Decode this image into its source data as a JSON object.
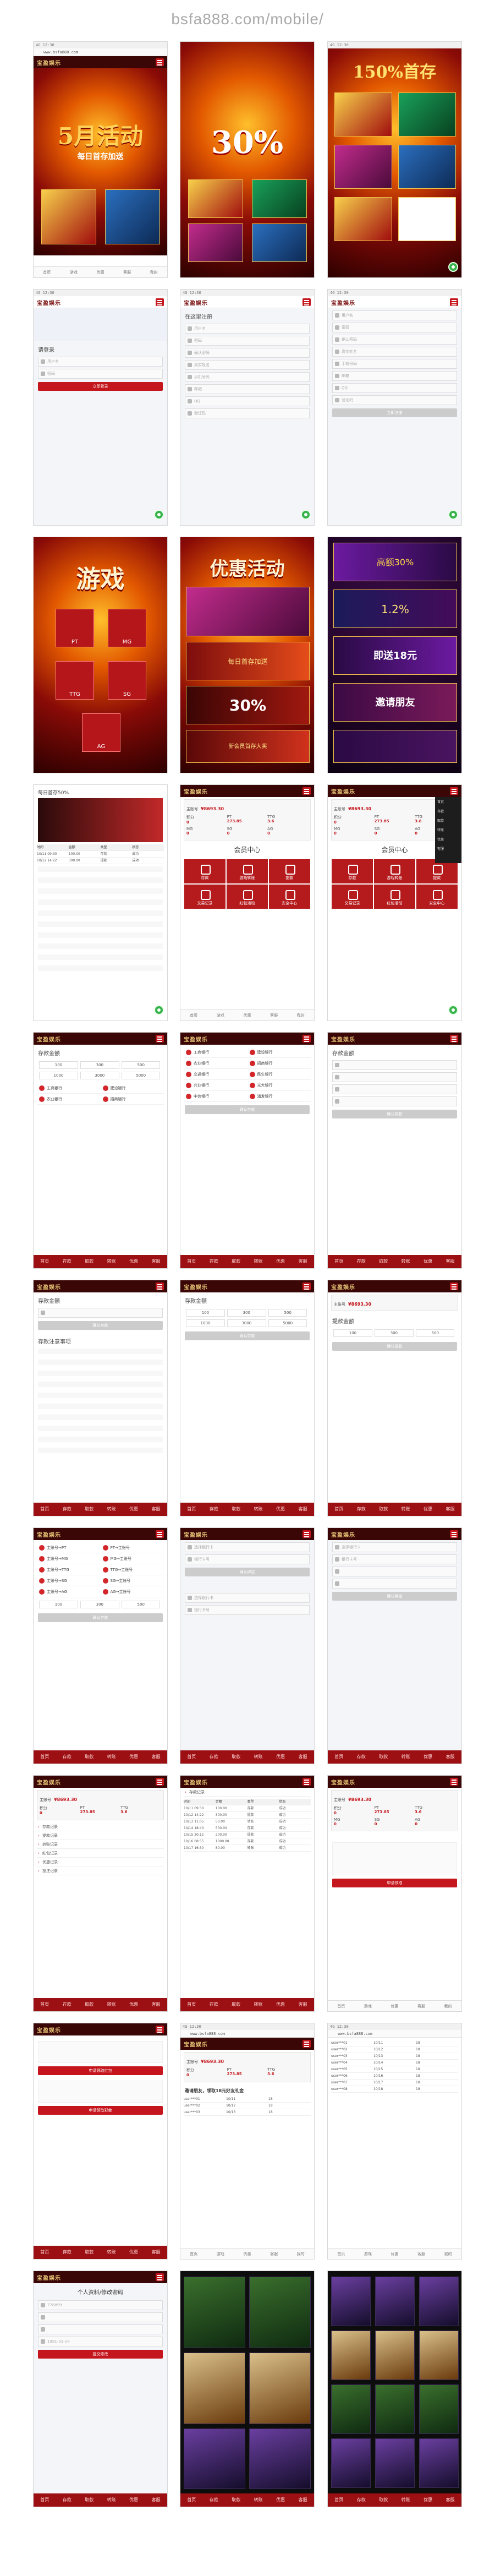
{
  "site_title": "bsfa888.com/mobile/",
  "logo_text": "宝盈娱乐",
  "status_time": "4G 12:30",
  "url_text": "www.bsfa888.com",
  "nav_items": [
    "首页",
    "存款",
    "取款",
    "转账",
    "优惠",
    "客服"
  ],
  "tab_items": [
    "首页",
    "游戏",
    "优惠",
    "客服",
    "我的"
  ],
  "row1": {
    "s1_banner": "5月活动",
    "s1_sub": "每日首存加送",
    "s2_banner": "30%",
    "s3_banner": "150%首存"
  },
  "row2": {
    "login_title": "请登录",
    "username_placeholder": "用户名",
    "password_placeholder": "密码",
    "login_btn": "立即登录",
    "register_title": "在这里注册",
    "reg_fields": [
      "用户名",
      "密码",
      "确认密码",
      "真实姓名",
      "手机号码",
      "邮箱",
      "QQ",
      "验证码"
    ],
    "submit_btn": "立即注册"
  },
  "row3": {
    "games_title": "游戏",
    "games": [
      "PT",
      "MG",
      "TTG",
      "SG",
      "AG"
    ],
    "promo_title": "优惠活动",
    "promo_items": [
      "每日首存加送",
      "30%",
      "新会员首存大奖"
    ],
    "promo2_items": [
      "高额30%",
      "1.2%",
      "即送18元",
      "邀请朋友"
    ]
  },
  "row4": {
    "bonus_title": "每日首存50%",
    "member_center": "会员中心",
    "account_label": "主账号",
    "account_amount": "¥8693.30",
    "balances": [
      {
        "name": "积分",
        "value": "0"
      },
      {
        "name": "PT",
        "value": "273.85"
      },
      {
        "name": "TTG",
        "value": "3.6"
      },
      {
        "name": "MG",
        "value": "0"
      },
      {
        "name": "SG",
        "value": "0"
      },
      {
        "name": "AG",
        "value": "0"
      }
    ],
    "center_items": [
      "存款",
      "游戏转账",
      "提款",
      "交易记录",
      "红包活动",
      "安全中心"
    ]
  },
  "row5": {
    "deposit_title": "存款金额",
    "banks": [
      "工商银行",
      "建设银行",
      "农业银行",
      "招商银行",
      "交通银行",
      "民生银行",
      "兴业银行",
      "光大银行",
      "中信银行",
      "浦发银行"
    ],
    "confirm_btn": "确认存款",
    "amounts": [
      "100",
      "300",
      "500",
      "1000",
      "3000",
      "5000"
    ]
  },
  "row6": {
    "withdraw_title": "提款金额",
    "notice_title": "存款注意事项",
    "withdraw_btn": "确认提款",
    "amount_label": "存款金额"
  },
  "row7": {
    "transfer_title": "主账号",
    "transfer_pairs": [
      "主账号→PT",
      "PT→主账号",
      "主账号→MG",
      "MG→主账号",
      "主账号→TTG",
      "TTG→主账号",
      "主账号→SG",
      "SG→主账号",
      "主账号→AG",
      "AG→主账号"
    ],
    "bank_select": "选择银行卡",
    "card_label": "银行卡号",
    "bind_btn": "确认绑定"
  },
  "row8": {
    "records": [
      "存款记录",
      "提款记录",
      "转账记录",
      "红包记录",
      "优惠记录",
      "投注记录"
    ],
    "record_headers": [
      "时间",
      "金额",
      "类型",
      "状态"
    ],
    "record_rows": [
      [
        "10/11 09:30",
        "100.00",
        "存款",
        "成功"
      ],
      [
        "10/12 14:22",
        "300.00",
        "提款",
        "成功"
      ],
      [
        "10/13 11:05",
        "50.00",
        "转账",
        "成功"
      ],
      [
        "10/14 18:40",
        "500.00",
        "存款",
        "成功"
      ],
      [
        "10/15 20:12",
        "200.00",
        "提款",
        "成功"
      ],
      [
        "10/16 08:55",
        "1000.00",
        "存款",
        "成功"
      ],
      [
        "10/17 16:30",
        "80.00",
        "转账",
        "成功"
      ]
    ],
    "apply_btn": "申请领取"
  },
  "row9": {
    "apply1": "申请领取红包",
    "apply2": "申请领取彩金",
    "invite_title": "邀请朋友，领取18元好友礼金",
    "invite_rows": [
      [
        "user***01",
        "10/11",
        "18"
      ],
      [
        "user***02",
        "10/12",
        "18"
      ],
      [
        "user***03",
        "10/13",
        "18"
      ],
      [
        "user***04",
        "10/14",
        "18"
      ],
      [
        "user***05",
        "10/15",
        "18"
      ],
      [
        "user***06",
        "10/16",
        "18"
      ],
      [
        "user***07",
        "10/17",
        "18"
      ],
      [
        "user***08",
        "10/18",
        "18"
      ]
    ]
  },
  "row10": {
    "profile_title": "个人资料/修改密码",
    "profile_fields": [
      "778899",
      "",
      "",
      "1981-01-14"
    ],
    "save_btn": "提交修改"
  }
}
